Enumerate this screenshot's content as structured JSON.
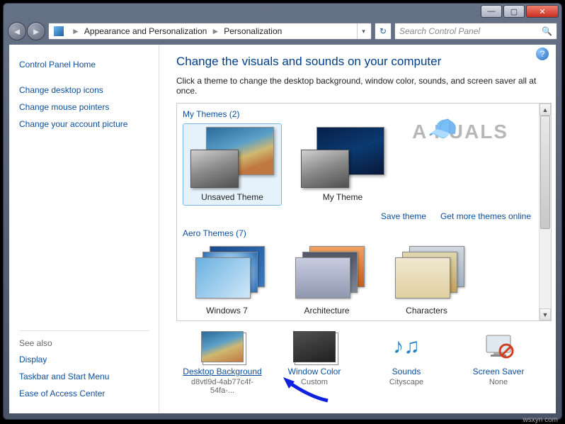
{
  "titlebar": {
    "minimize": "—",
    "maximize": "▢",
    "close": "✕"
  },
  "nav": {
    "back": "◄",
    "forward": "►",
    "refresh": "↻"
  },
  "breadcrumb": {
    "level1": "Appearance and Personalization",
    "level2": "Personalization",
    "sep": "►"
  },
  "search": {
    "placeholder": "Search Control Panel"
  },
  "sidebar": {
    "home": "Control Panel Home",
    "links": [
      "Change desktop icons",
      "Change mouse pointers",
      "Change your account picture"
    ],
    "seealso_label": "See also",
    "seealso": [
      "Display",
      "Taskbar and Start Menu",
      "Ease of Access Center"
    ]
  },
  "main": {
    "title": "Change the visuals and sounds on your computer",
    "intro": "Click a theme to change the desktop background, window color, sounds, and screen saver all at once.",
    "help": "?"
  },
  "groups": {
    "my_themes": {
      "label": "My Themes (2)"
    },
    "aero_themes": {
      "label": "Aero Themes (7)"
    }
  },
  "my_themes": [
    {
      "label": "Unsaved Theme"
    },
    {
      "label": "My Theme"
    }
  ],
  "theme_actions": {
    "save": "Save theme",
    "more": "Get more themes online"
  },
  "aero_themes": [
    {
      "label": "Windows 7"
    },
    {
      "label": "Architecture"
    },
    {
      "label": "Characters"
    }
  ],
  "bottom": {
    "desktop_bg": {
      "label": "Desktop Background",
      "sub": "d8vtl9d-4ab77c4f-54fa-..."
    },
    "window_color": {
      "label": "Window Color",
      "sub": "Custom"
    },
    "sounds": {
      "label": "Sounds",
      "sub": "Cityscape",
      "icon": "♪♫"
    },
    "screensaver": {
      "label": "Screen Saver",
      "sub": "None"
    }
  },
  "watermark_brand": "A  PUALS",
  "footer": "wsxyn com"
}
